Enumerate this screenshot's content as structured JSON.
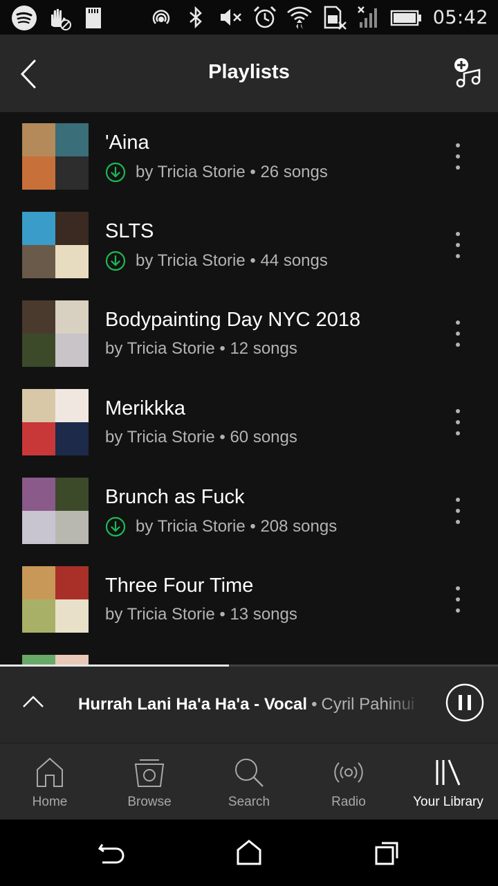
{
  "status_bar": {
    "time": "05:42",
    "left_icons": [
      "spotify-icon",
      "no-touch-icon",
      "sd-card-icon"
    ],
    "right_icons": [
      "hotspot-icon",
      "bluetooth-icon",
      "mute-icon",
      "alarm-icon",
      "wifi-icon",
      "no-sim-icon",
      "signal-icon",
      "battery-icon"
    ]
  },
  "header": {
    "title": "Playlists",
    "back_icon": "back-arrow-icon",
    "add_icon": "add-music-icon"
  },
  "playlists": [
    {
      "title": "'Aina",
      "subtitle": "by Tricia Storie • 26 songs",
      "downloaded": true,
      "cover_colors": [
        "#b48a5a",
        "#3a6e78",
        "#c8703a",
        "#2d2d2d"
      ]
    },
    {
      "title": "SLTS",
      "subtitle": "by Tricia Storie • 44 songs",
      "downloaded": true,
      "cover_colors": [
        "#3a9cc8",
        "#3a2a22",
        "#6a5a4a",
        "#e8dcc0"
      ]
    },
    {
      "title": "Bodypainting Day NYC 2018",
      "subtitle": "by Tricia Storie • 12 songs",
      "downloaded": false,
      "cover_colors": [
        "#4a3a2e",
        "#d8d0c0",
        "#3c4a2a",
        "#c8c4c8"
      ]
    },
    {
      "title": "Merikkka",
      "subtitle": "by Tricia Storie • 60 songs",
      "downloaded": false,
      "cover_colors": [
        "#d8c8a8",
        "#f0e8e0",
        "#c83838",
        "#1e2a4a"
      ]
    },
    {
      "title": "Brunch as Fuck",
      "subtitle": "by Tricia Storie • 208 songs",
      "downloaded": true,
      "cover_colors": [
        "#8a5a8a",
        "#3c4a2a",
        "#c8c4d0",
        "#b8b8b0"
      ]
    },
    {
      "title": "Three Four Time",
      "subtitle": "by Tricia Storie • 13 songs",
      "downloaded": false,
      "cover_colors": [
        "#c89858",
        "#a83028",
        "#a8b068",
        "#e8e0c8"
      ]
    },
    {
      "title": "",
      "subtitle": "",
      "downloaded": false,
      "cover_colors": [
        "#68a868",
        "#e8c8b8",
        "#3a3a3a",
        "#3a3a3a"
      ]
    }
  ],
  "now_playing": {
    "track": "Hurrah Lani Ha'a Ha'a - Vocal",
    "separator": "•",
    "artist": "Cyril Pahinui",
    "progress": 0.46,
    "expand_icon": "chevron-up-icon",
    "control_icon": "pause-icon"
  },
  "bottom_nav": [
    {
      "label": "Home",
      "icon": "home-icon",
      "active": false
    },
    {
      "label": "Browse",
      "icon": "browse-icon",
      "active": false
    },
    {
      "label": "Search",
      "icon": "search-icon",
      "active": false
    },
    {
      "label": "Radio",
      "icon": "radio-icon",
      "active": false
    },
    {
      "label": "Your Library",
      "icon": "library-icon",
      "active": true
    }
  ],
  "colors": {
    "accent_green": "#1db954",
    "background": "#121212",
    "header": "#282828",
    "secondary_text": "#b3b3b3"
  }
}
